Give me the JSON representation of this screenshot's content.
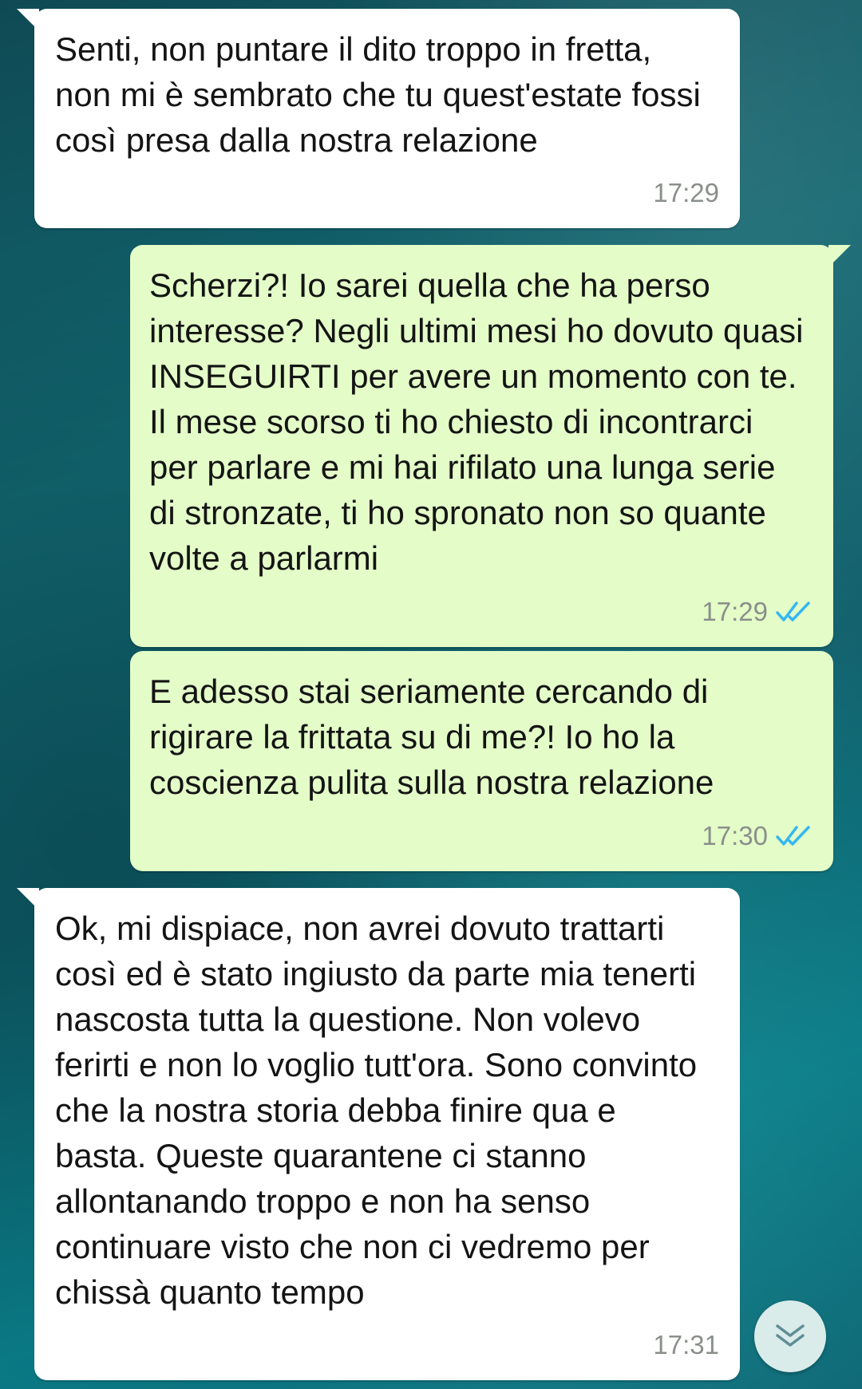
{
  "messages": [
    {
      "direction": "incoming",
      "text": "Senti, non puntare il dito troppo in fretta, non mi è sembrato che tu quest'estate fossi così presa dalla nostra relazione",
      "time": "17:29"
    },
    {
      "direction": "outgoing",
      "text": "Scherzi?! Io sarei quella che ha perso interesse? Negli ultimi mesi ho dovuto quasi INSEGUIRTI per avere un momento con te. Il mese scorso ti ho chiesto di incontrarci per parlare e mi hai rifilato una lunga serie di stronzate, ti ho spronato non so quante volte a parlarmi",
      "time": "17:29",
      "status": "read"
    },
    {
      "direction": "outgoing",
      "text": "E adesso stai seriamente cercando di rigirare la frittata su di me?! Io ho la coscienza pulita sulla nostra relazione",
      "time": "17:30",
      "status": "read"
    },
    {
      "direction": "incoming",
      "text": "Ok, mi dispiace, non avrei dovuto trattarti così ed è stato ingiusto da parte mia tenerti nascosta tutta la questione. Non volevo ferirti e non lo voglio tutt'ora. Sono convinto che la nostra storia debba finire qua e basta. Queste quarantene ci stanno allontanando troppo e non ha senso continuare visto che non ci vedremo per chissà quanto tempo",
      "time": "17:31"
    }
  ],
  "icons": {
    "read_receipt": "double-check-icon",
    "scroll_down": "double-chevron-down-icon"
  },
  "colors": {
    "incoming_bubble": "#ffffff",
    "outgoing_bubble": "#e3fcc8",
    "read_check": "#34b7f1",
    "timestamp": "#8a8f8a"
  }
}
